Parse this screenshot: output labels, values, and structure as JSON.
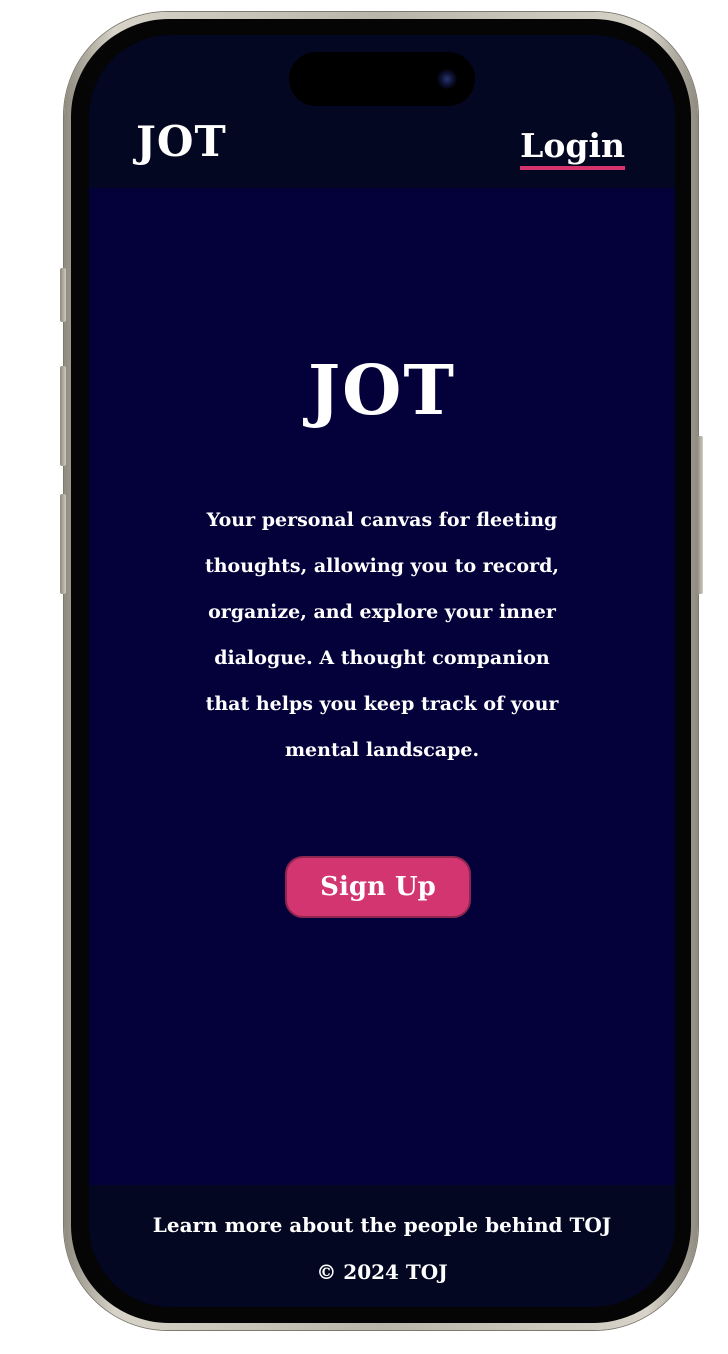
{
  "header": {
    "brand": "JOT",
    "login_label": "Login"
  },
  "hero": {
    "title": "JOT",
    "description": "Your personal canvas for fleeting thoughts, allowing you to record, organize, and explore your inner dialogue. A thought companion that helps you keep track of your mental landscape.",
    "signup_label": "Sign Up"
  },
  "footer": {
    "about_link": "Learn more about the people behind TOJ",
    "copyright": "© 2024 TOJ"
  },
  "colors": {
    "background": "#04003a",
    "header_footer": "#040721",
    "accent": "#d2356f"
  }
}
